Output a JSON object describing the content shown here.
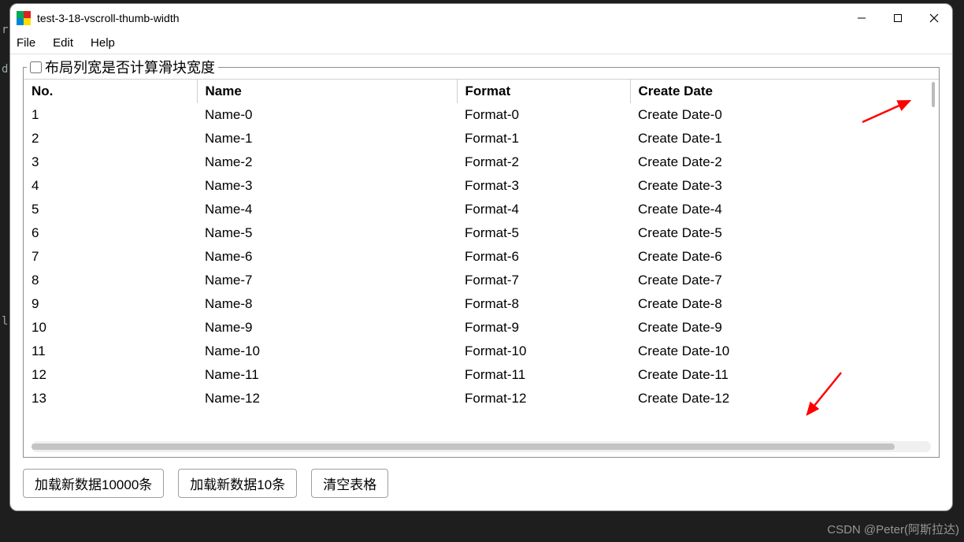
{
  "window": {
    "title": "test-3-18-vscroll-thumb-width"
  },
  "menu": {
    "file": "File",
    "edit": "Edit",
    "help": "Help"
  },
  "group": {
    "checkbox_label": "布局列宽是否计算滑块宽度"
  },
  "table": {
    "headers": {
      "no": "No.",
      "name": "Name",
      "format": "Format",
      "create": "Create Date"
    },
    "rows": [
      {
        "no": "1",
        "name": "Name-0",
        "format": "Format-0",
        "create": "Create Date-0"
      },
      {
        "no": "2",
        "name": "Name-1",
        "format": "Format-1",
        "create": "Create Date-1"
      },
      {
        "no": "3",
        "name": "Name-2",
        "format": "Format-2",
        "create": "Create Date-2"
      },
      {
        "no": "4",
        "name": "Name-3",
        "format": "Format-3",
        "create": "Create Date-3"
      },
      {
        "no": "5",
        "name": "Name-4",
        "format": "Format-4",
        "create": "Create Date-4"
      },
      {
        "no": "6",
        "name": "Name-5",
        "format": "Format-5",
        "create": "Create Date-5"
      },
      {
        "no": "7",
        "name": "Name-6",
        "format": "Format-6",
        "create": "Create Date-6"
      },
      {
        "no": "8",
        "name": "Name-7",
        "format": "Format-7",
        "create": "Create Date-7"
      },
      {
        "no": "9",
        "name": "Name-8",
        "format": "Format-8",
        "create": "Create Date-8"
      },
      {
        "no": "10",
        "name": "Name-9",
        "format": "Format-9",
        "create": "Create Date-9"
      },
      {
        "no": "11",
        "name": "Name-10",
        "format": "Format-10",
        "create": "Create Date-10"
      },
      {
        "no": "12",
        "name": "Name-11",
        "format": "Format-11",
        "create": "Create Date-11"
      },
      {
        "no": "13",
        "name": "Name-12",
        "format": "Format-12",
        "create": "Create Date-12"
      }
    ]
  },
  "buttons": {
    "load10000": "加载新数据10000条",
    "load10": "加载新数据10条",
    "clear": "清空表格"
  },
  "watermark": "CSDN @Peter(阿斯拉达)"
}
